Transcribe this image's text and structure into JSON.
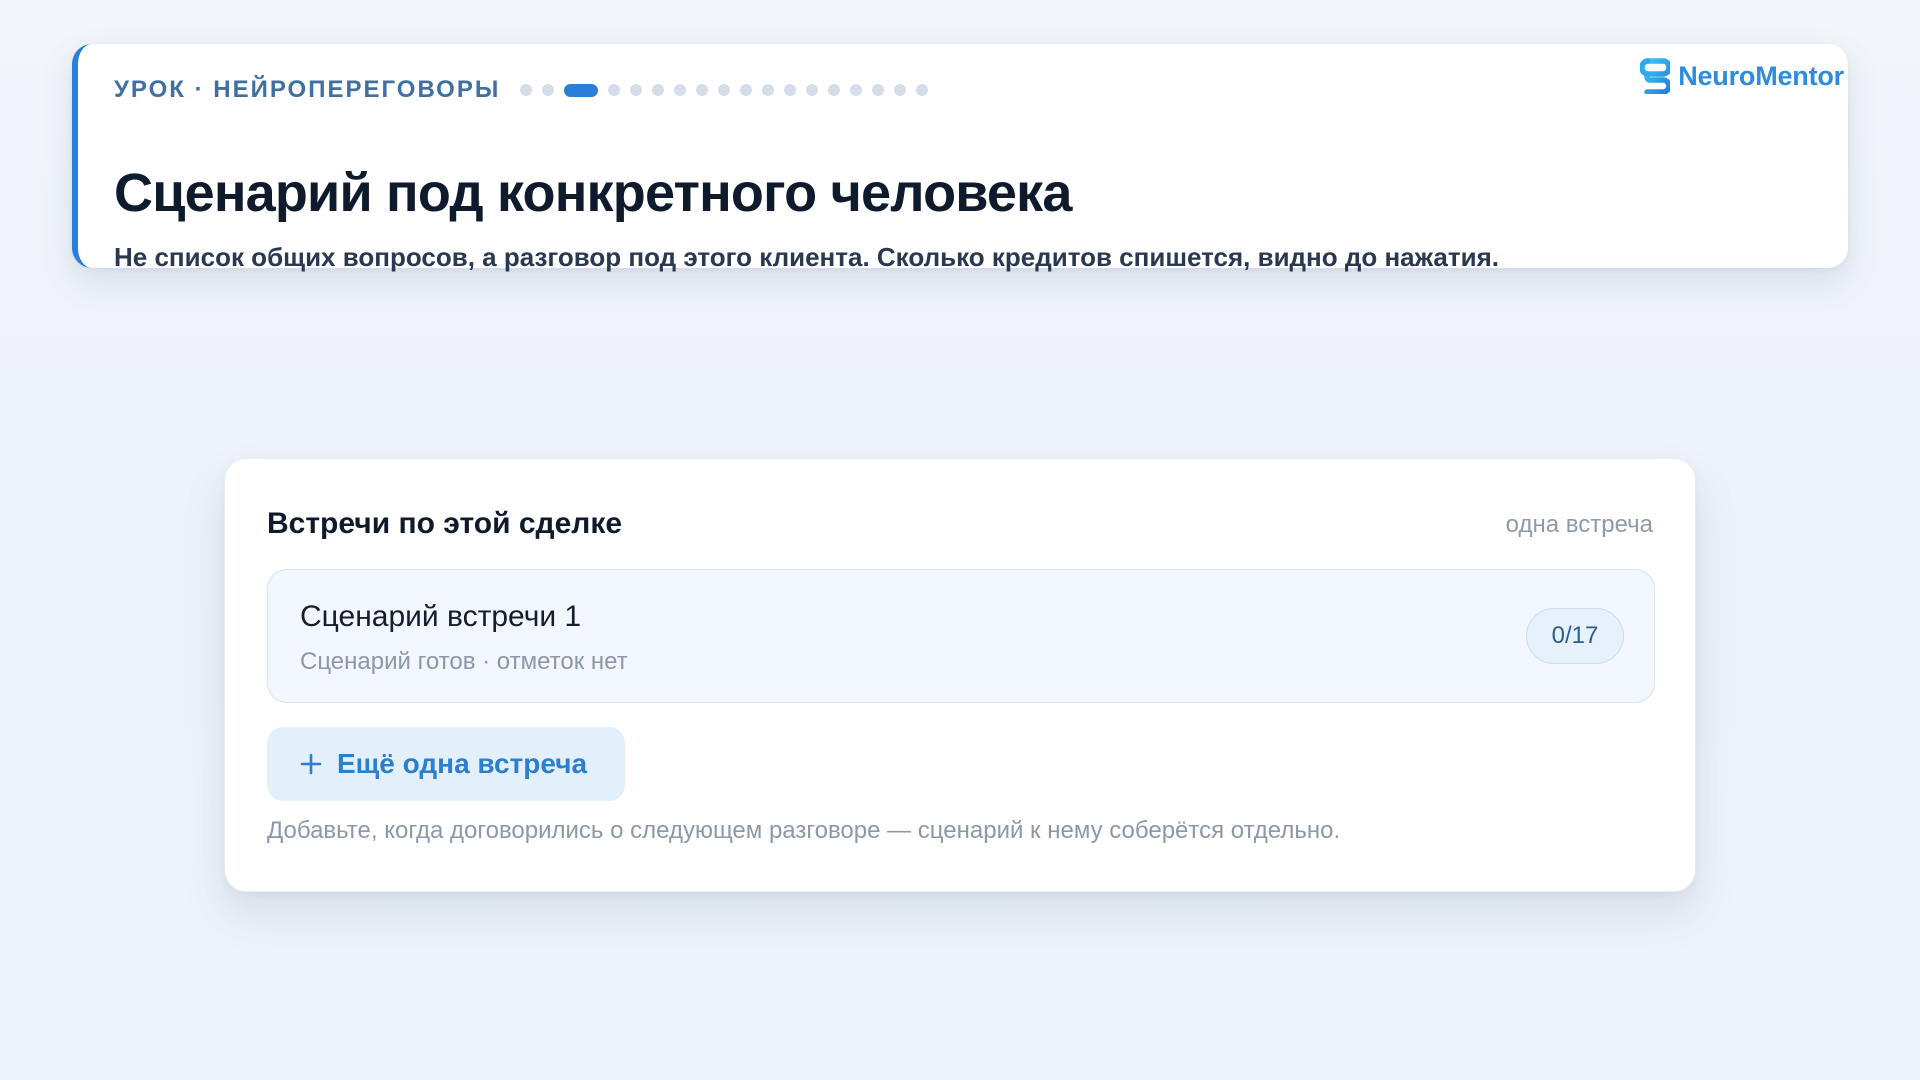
{
  "lesson": {
    "eyebrow": "УРОК · НЕЙРОПЕРЕГОВОРЫ",
    "title": "Сценарий под конкретного человека",
    "subtitle": "Не список общих вопросов, а разговор под этого клиента. Сколько кредитов спишется, видно до нажатия.",
    "progress": {
      "total_steps": 18,
      "current_step": 3
    }
  },
  "brand": {
    "name": "NeuroMentor",
    "logo_icon": "neuromentor-logo-icon",
    "color": "#2d8be0"
  },
  "meetings": {
    "title": "Встречи по этой сделке",
    "count_label": "одна встреча",
    "items": [
      {
        "name": "Сценарий встречи 1",
        "status": "Сценарий готов · отметок нет",
        "badge": "0/17"
      }
    ],
    "add_button": {
      "icon": "plus-icon",
      "label": "Ещё одна встреча"
    },
    "hint": "Добавьте, когда договорились о следующем разговоре — сценарий к нему соберётся отдельно."
  },
  "colors": {
    "accent": "#2b7fd8",
    "background": "#eef3f9",
    "card": "#ffffff",
    "muted_text": "#8c98a9"
  }
}
